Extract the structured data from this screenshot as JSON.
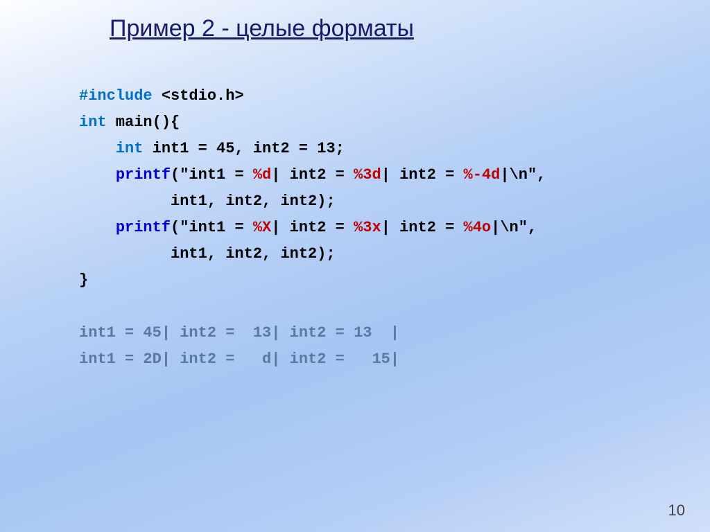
{
  "title": "Пример 2 - целые форматы",
  "page_number": "10",
  "code": {
    "l1a": "#include",
    "l1b": " <stdio.h>",
    "l2a": "int",
    "l2b": " main(){",
    "l3a": "    ",
    "l3b": "int",
    "l3c": " int1 = 45, int2 = 13;",
    "l4a": "    ",
    "l4b": "printf",
    "l4c": "(\"int1 = ",
    "l4d": "%d",
    "l4e": "| int2 = ",
    "l4f": "%3d",
    "l4g": "| int2 = ",
    "l4h": "%-4d",
    "l4i": "|\\n\",",
    "l5": "          int1, int2, int2);",
    "l6a": "    ",
    "l6b": "printf",
    "l6c": "(\"int1 = ",
    "l6d": "%X",
    "l6e": "| int2 = ",
    "l6f": "%3x",
    "l6g": "| int2 = ",
    "l6h": "%4o",
    "l6i": "|\\n\",",
    "l7": "          int1, int2, int2);",
    "l8": "}",
    "blank": "",
    "out1": "int1 = 45| int2 =  13| int2 = 13  |",
    "out2": "int1 = 2D| int2 =   d| int2 =   15|"
  }
}
